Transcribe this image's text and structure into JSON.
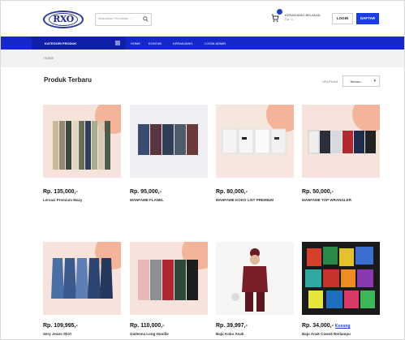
{
  "header": {
    "logo_text": "RXO",
    "search_placeholder": "Masukkan Pencarian ...",
    "cart_title": "KERANJANG BELANJA :",
    "cart_value": "Rp. 0,-",
    "login_label": "LOGIN",
    "daftar_label": "DAFTAR"
  },
  "navbar": {
    "category_label": "KATEGORI PRODUK",
    "links": [
      "HOME",
      "KONTAK",
      "KERANJANG",
      "LOGIN ADMIN"
    ]
  },
  "breadcrumb": "Home",
  "section": {
    "title": "Produk Terbaru",
    "sort_label": "URUTKAN",
    "sort_value": "Terbaru"
  },
  "colors": {
    "primary": "#1528c9",
    "button": "#1a3ee0",
    "photo_bg": "#f4e2da",
    "accent_blob": "#f3b49a"
  },
  "products": [
    {
      "price": "Rp. 135,000,-",
      "name": "Lervazi Premium Mazy",
      "status": ""
    },
    {
      "price": "Rp. 95,000,-",
      "name": "MANFAME FLANEL",
      "status": ""
    },
    {
      "price": "Rp. 80,000,-",
      "name": "MANFAME KOKO LIST PREMIUM",
      "status": ""
    },
    {
      "price": "Rp. 50,000,-",
      "name": "MANFAME TOP WRANGLER",
      "status": ""
    },
    {
      "price": "Rp. 109,995,-",
      "name": "Sery Jeans Skirt",
      "status": ""
    },
    {
      "price": "Rp. 110,000,-",
      "name": "Gadeena Long Hoodie",
      "status": ""
    },
    {
      "price": "Rp. 39,997,-",
      "name": "Baju Koko Anak",
      "status": ""
    },
    {
      "price": "Rp. 34,000,-",
      "name": "Baju Anak Cowok Berlampu",
      "status": "Kosong"
    }
  ]
}
